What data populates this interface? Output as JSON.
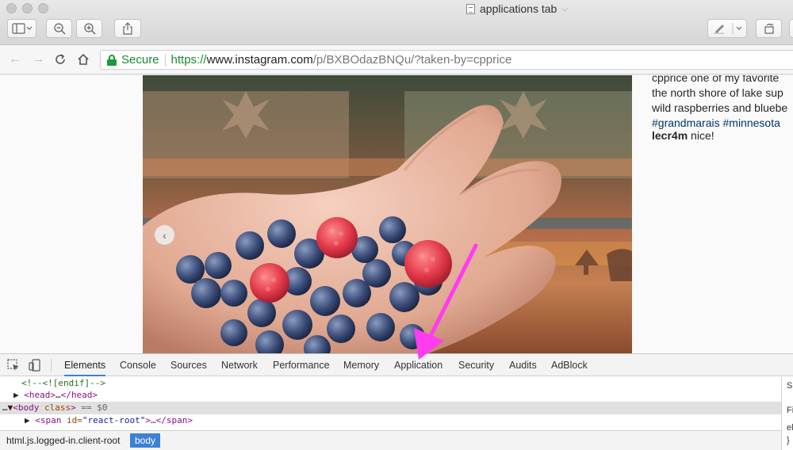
{
  "window": {
    "title": "applications tab"
  },
  "address_bar": {
    "secure_label": "Secure",
    "url_scheme": "https://",
    "url_domain": "www.instagram.com",
    "url_path": "/p/BXBOdazBNQu/?taken-by=cpprice"
  },
  "post": {
    "caption_lines": [
      "cpprice one of my favorite",
      "the north shore of lake sup",
      "wild raspberries and bluebe"
    ],
    "caption_tags": "#grandmarais #minnesota",
    "comment_user": "lecr4m",
    "comment_text": " nice!"
  },
  "devtools": {
    "tabs": [
      "Elements",
      "Console",
      "Sources",
      "Network",
      "Performance",
      "Memory",
      "Application",
      "Security",
      "Audits",
      "AdBlock"
    ],
    "active_tab": "Elements",
    "dom": {
      "line1": "<!--<![endif]-->",
      "line2_tag_open": "<head>",
      "line2_ellipsis": "…",
      "line2_tag_close": "</head>",
      "line3_tag": "<body",
      "line3_attr": " class",
      "line3_end": ">",
      "line3_eq": " == $0",
      "line4_tag": "<span",
      "line4_attr": " id=",
      "line4_val": "\"react-root\"",
      "line4_end": ">…</span>"
    },
    "breadcrumbs": [
      "html.js.logged-in.client-root",
      "body"
    ],
    "styles_pane_glyphs": [
      "S",
      "Fi",
      "el",
      "}"
    ]
  },
  "colors": {
    "accent": "#3b82d6",
    "secure_green": "#1a8a34",
    "arrow_magenta": "#ff3cf0"
  }
}
